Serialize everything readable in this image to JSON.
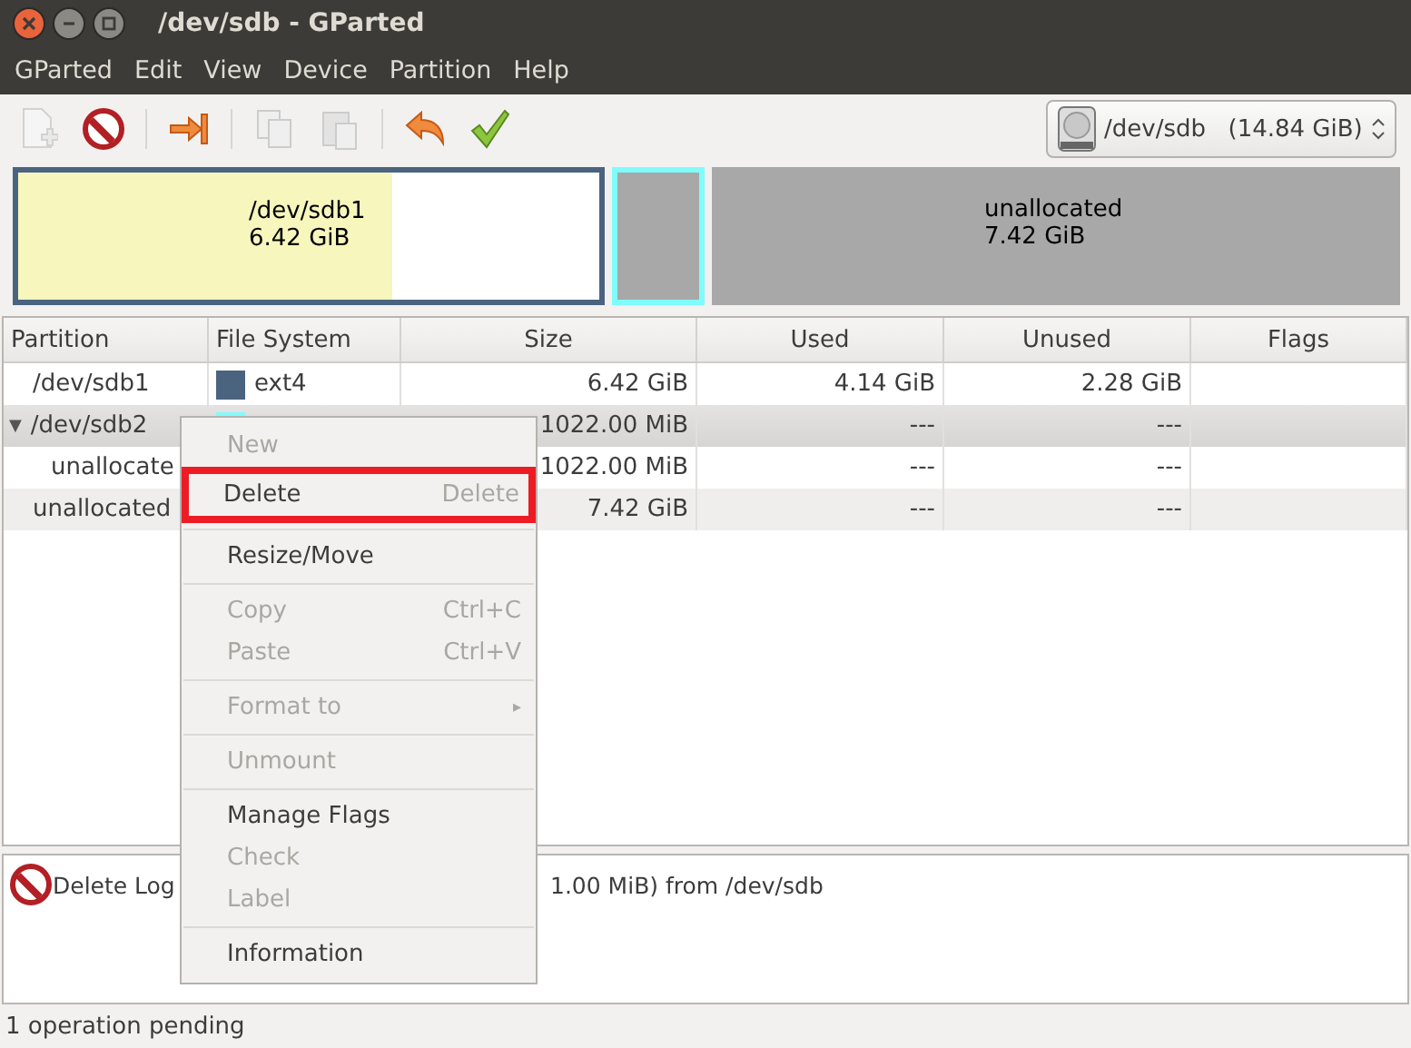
{
  "window": {
    "title": "/dev/sdb - GParted"
  },
  "menu_bar": [
    "GParted",
    "Edit",
    "View",
    "Device",
    "Partition",
    "Help"
  ],
  "toolbar": [
    {
      "kind": "new",
      "disabled": true
    },
    {
      "kind": "delete",
      "disabled": false
    },
    {
      "kind": "separator"
    },
    {
      "kind": "resize",
      "disabled": false
    },
    {
      "kind": "separator"
    },
    {
      "kind": "copy",
      "disabled": true
    },
    {
      "kind": "paste",
      "disabled": true
    },
    {
      "kind": "separator"
    },
    {
      "kind": "undo",
      "disabled": false
    },
    {
      "kind": "apply",
      "disabled": false
    }
  ],
  "device_selector": {
    "device": "/dev/sdb",
    "size": "(14.84 GiB)"
  },
  "disk_map": [
    {
      "kind": "partition",
      "name": "/dev/sdb1",
      "size": "6.42 GiB",
      "level": 0.645,
      "color": "#4a6480"
    },
    {
      "kind": "extended",
      "color": "#7ffcfc"
    },
    {
      "kind": "unallocated",
      "name": "unallocated",
      "size": "7.42 GiB"
    }
  ],
  "table": {
    "columns": [
      "Partition",
      "File System",
      "Size",
      "Used",
      "Unused",
      "Flags"
    ],
    "rows": [
      {
        "partition": "/dev/sdb1",
        "file_system": "ext4",
        "color": "#4a6480",
        "size": "6.42 GiB",
        "used": "4.14 GiB",
        "unused": "2.28 GiB",
        "selected": false,
        "children": []
      },
      {
        "partition": "/dev/sdb2",
        "color": "#7ffcfc",
        "size": "1022.00 MiB",
        "used": "---",
        "unused": "---",
        "selected": true,
        "expander": "▼",
        "expanded": true,
        "children": [
          {
            "partition": "unallocate",
            "size": "1022.00 MiB",
            "used": "---",
            "unused": "---",
            "selected": false
          }
        ]
      },
      {
        "partition": "unallocated",
        "size": "7.42 GiB",
        "used": "---",
        "unused": "---",
        "selected": false,
        "children": []
      }
    ]
  },
  "context_menu": [
    {
      "kind": "item",
      "label": "New",
      "disabled": true,
      "highlighted": false
    },
    {
      "kind": "item",
      "label": "Delete",
      "shortcut": "Delete",
      "disabled": false,
      "highlighted": true
    },
    {
      "kind": "separator"
    },
    {
      "kind": "item",
      "label": "Resize/Move",
      "disabled": false,
      "highlighted": false
    },
    {
      "kind": "separator"
    },
    {
      "kind": "item",
      "label": "Copy",
      "shortcut": "Ctrl+C",
      "disabled": true,
      "highlighted": false
    },
    {
      "kind": "item",
      "label": "Paste",
      "shortcut": "Ctrl+V",
      "disabled": true,
      "highlighted": false
    },
    {
      "kind": "separator"
    },
    {
      "kind": "item",
      "label": "Format to",
      "submenu": "▸",
      "disabled": true,
      "highlighted": false
    },
    {
      "kind": "separator"
    },
    {
      "kind": "item",
      "label": "Unmount",
      "disabled": true,
      "highlighted": false
    },
    {
      "kind": "separator"
    },
    {
      "kind": "item",
      "label": "Manage Flags",
      "disabled": false,
      "highlighted": false
    },
    {
      "kind": "item",
      "label": "Check",
      "disabled": true,
      "highlighted": false
    },
    {
      "kind": "item",
      "label": "Label",
      "disabled": true,
      "highlighted": false
    },
    {
      "kind": "separator"
    },
    {
      "kind": "item",
      "label": "Information",
      "disabled": false,
      "highlighted": false
    }
  ],
  "operations": [
    {
      "kind": "delete",
      "text_start": "Delete Log",
      "text_end": "1.00 MiB) from /dev/sdb"
    }
  ],
  "status_bar": "1 operation pending"
}
